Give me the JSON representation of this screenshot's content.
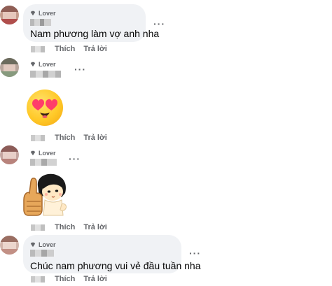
{
  "badge_label": "Lover",
  "more_glyph": "···",
  "actions": {
    "like": "Thích",
    "reply": "Trả lời"
  },
  "comments": [
    {
      "text": "Nam phương làm vợ anh nha"
    },
    {
      "sticker": "heart-eyes-emoji"
    },
    {
      "sticker": "thumbs-up-girl-sticker"
    },
    {
      "text": "Chúc nam phương vui vẻ đầu tuần nha"
    }
  ],
  "colors": {
    "bubble": "#f0f2f5",
    "secondary_text": "#65676b",
    "primary_text": "#050505"
  }
}
